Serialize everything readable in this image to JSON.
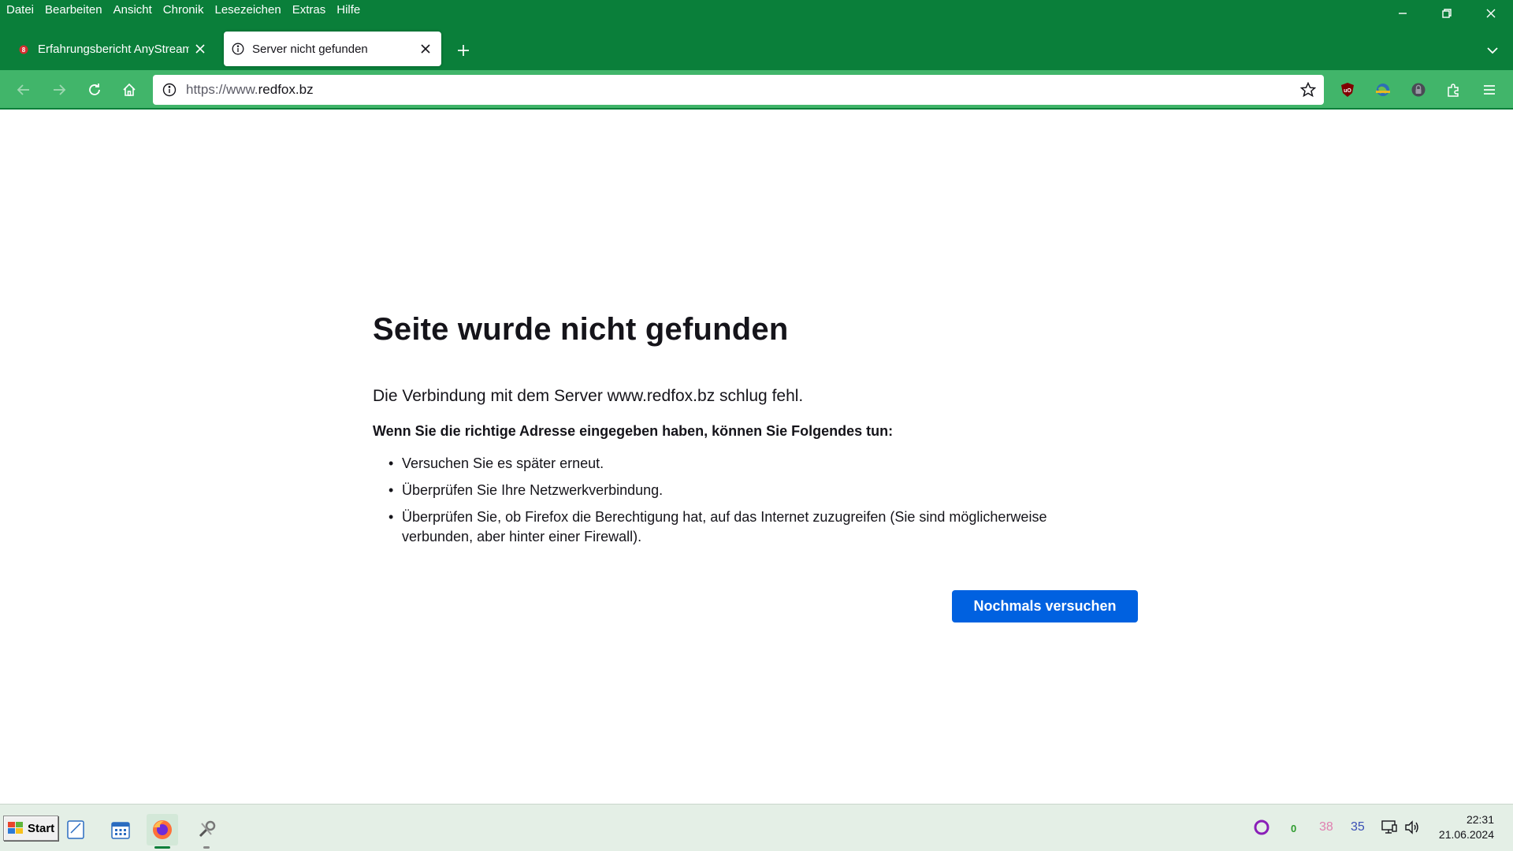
{
  "menu": {
    "items": [
      "Datei",
      "Bearbeiten",
      "Ansicht",
      "Chronik",
      "Lesezeichen",
      "Extras",
      "Hilfe"
    ]
  },
  "tabs": [
    {
      "title": "Erfahrungsbericht AnyStream /",
      "badge": "8",
      "active": false
    },
    {
      "title": "Server nicht gefunden",
      "active": true
    }
  ],
  "navbar": {
    "url_prefix": "https://www.",
    "url_domain": "redfox.bz"
  },
  "error": {
    "title": "Seite wurde nicht gefunden",
    "description": "Die Verbindung mit dem Server www.redfox.bz schlug fehl.",
    "hint": "Wenn Sie die richtige Adresse eingegeben haben, können Sie Folgendes tun:",
    "suggestions": [
      "Versuchen Sie es später erneut.",
      "Überprüfen Sie Ihre Netzwerkverbindung.",
      "Überprüfen Sie, ob Firefox die Berechtigung hat, auf das Internet zuzugreifen (Sie sind möglicherweise verbunden, aber hinter einer Firewall)."
    ],
    "retry_label": "Nochmals versuchen"
  },
  "taskbar": {
    "start_label": "Start",
    "tray": {
      "counter_green": "0",
      "counter_pink": "38",
      "counter_blue": "35"
    },
    "time": "22:31",
    "date": "21.06.2024"
  },
  "colors": {
    "titlebar": "#0a7f3a",
    "navbar": "#41b56a",
    "primary_button": "#0061e0",
    "taskbar": "#e4efe6"
  }
}
